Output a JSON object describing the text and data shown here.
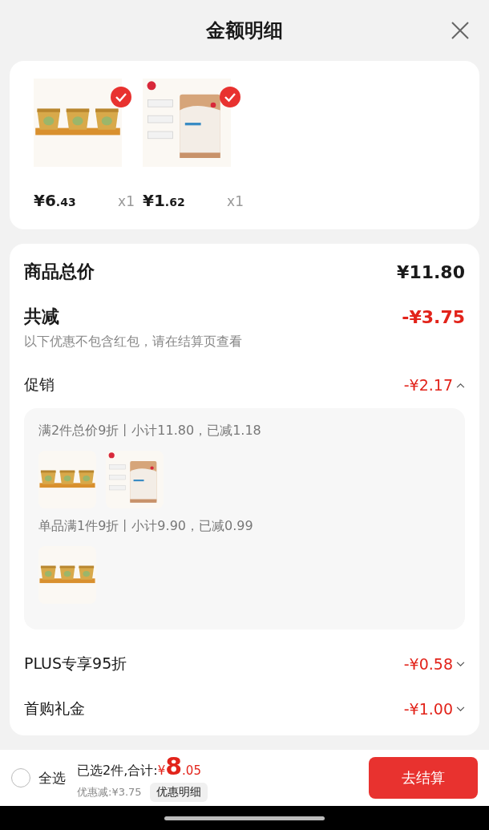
{
  "header": {
    "title": "金额明细"
  },
  "products": [
    {
      "price": "¥6",
      "price_cents": ".43",
      "quantity": "x1",
      "checked": true
    },
    {
      "price": "¥1",
      "price_cents": ".62",
      "quantity": "x1",
      "checked": true
    }
  ],
  "summary": {
    "total_label": "商品总价",
    "total_value": "¥11.80",
    "reduction_label": "共减",
    "reduction_value": "-¥3.75",
    "note": "以下优惠不包含红包，请在结算页查看"
  },
  "discounts": [
    {
      "label": "促销",
      "value": "-¥2.17",
      "expanded": true,
      "groups": [
        {
          "text": "满2件总价9折丨小计11.80，已减1.18"
        },
        {
          "text": "单品满1件9折丨小计9.90，已减0.99"
        }
      ]
    },
    {
      "label": "PLUS专享95折",
      "value": "-¥0.58",
      "expanded": false
    },
    {
      "label": "首购礼金",
      "value": "-¥1.00",
      "expanded": false
    }
  ],
  "footer": {
    "select_all_checked": false,
    "select_all_label": "全选",
    "selected_text": "已选2件,合计:",
    "total_symbol": "¥",
    "total_main": "8",
    "total_cents": ".05",
    "discount_text": "优惠减:¥3.75",
    "details_button": "优惠明细",
    "checkout_button": "去结算"
  }
}
